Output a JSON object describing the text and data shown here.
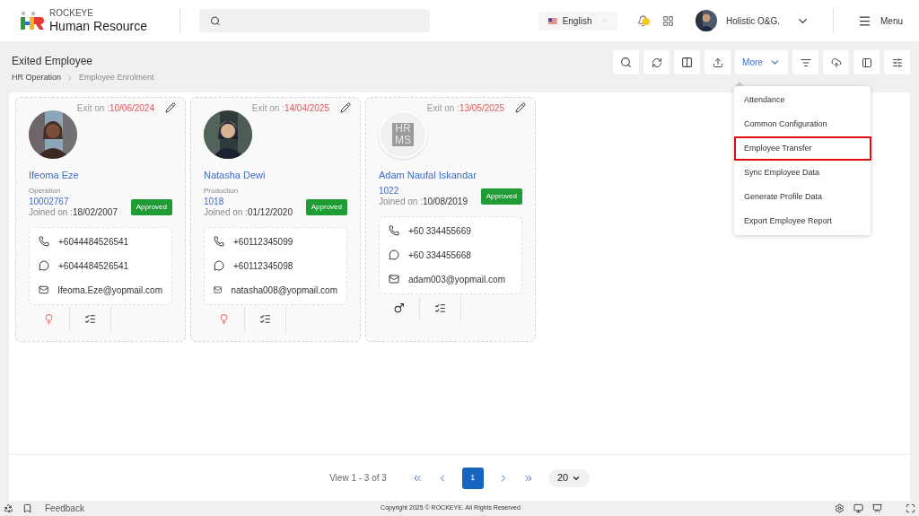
{
  "header": {
    "brand_top": "ROCKEYE",
    "brand_name": "Human Resource",
    "language": "English",
    "user": "Holistic O&G.",
    "menu": "Menu"
  },
  "page": {
    "title": "Exited Employee",
    "breadcrumb": [
      "HR Operation",
      "Employee Enrolment"
    ]
  },
  "toolbar": {
    "more": "More"
  },
  "more_menu": [
    {
      "label": "Attendance",
      "highlighted": false
    },
    {
      "label": "Common Configuration",
      "highlighted": false
    },
    {
      "label": "Employee Transfer",
      "highlighted": true
    },
    {
      "label": "Sync Employee Data",
      "highlighted": false
    },
    {
      "label": "Generate Profile Data",
      "highlighted": false
    },
    {
      "label": "Export Employee Report",
      "highlighted": false
    }
  ],
  "cards": [
    {
      "exit_label": "Exit on :",
      "exit_date": "10/06/2024",
      "name": "Ifeoma Eze",
      "department": "Operation",
      "code": "10002767",
      "joined_label": "Joined on :",
      "joined_date": "18/02/2007",
      "status": "Approved",
      "phone": "+6044484526541",
      "whatsapp": "+6044484526541",
      "email": "Ifeoma.Eze@yopmail.com",
      "male": false
    },
    {
      "exit_label": "Exit on :",
      "exit_date": "14/04/2025",
      "name": "Natasha Dewi",
      "department": "Production",
      "code": "1018",
      "joined_label": "Joined on :",
      "joined_date": "01/12/2020",
      "status": "Approved",
      "phone": "+60112345099",
      "whatsapp": "+60112345098",
      "email": "natasha008@yopmail.com",
      "male": false
    },
    {
      "exit_label": "Exit on :",
      "exit_date": "13/05/2025",
      "avatar": {
        "kind": "placeholder",
        "text": [
          "HR",
          "MS"
        ]
      },
      "name": "Adam Naufal Iskandar",
      "code": "1022",
      "joined_label": "Joined on :",
      "joined_date": "10/08/2019",
      "status": "Approved",
      "phone": "+60 334455669",
      "whatsapp": "+60 334455668",
      "email": "adam003@yopmail.com",
      "male": true
    }
  ],
  "pagination": {
    "summary": "View 1 - 3 of 3",
    "pages": [
      {
        "label": "1",
        "selected": true
      }
    ],
    "page_size": "20"
  },
  "footer": {
    "feedback": "Feedback",
    "copyright": "Copyright 2025 © ROCKEYE. All Rights Reserved"
  }
}
